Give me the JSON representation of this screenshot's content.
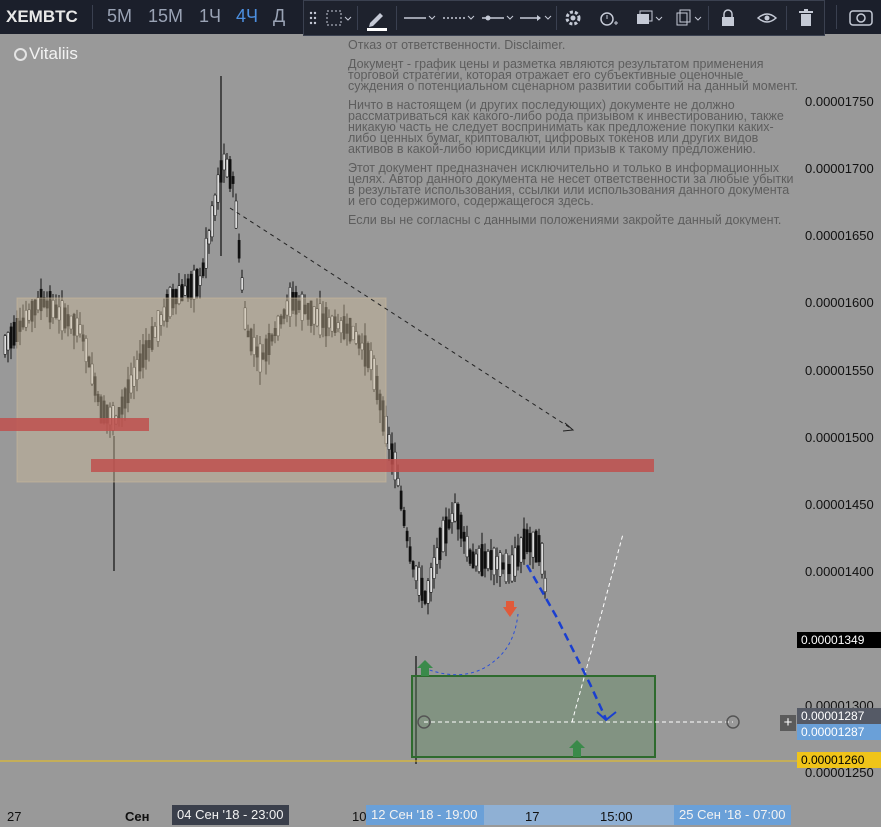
{
  "header": {
    "symbol": "XEMBTC",
    "timeframes": [
      {
        "label": "5M",
        "active": false
      },
      {
        "label": "15M",
        "active": false
      },
      {
        "label": "1Ч",
        "active": false
      },
      {
        "label": "4Ч",
        "active": true
      },
      {
        "label": "Д",
        "active": false
      }
    ]
  },
  "drawing_toolbar": {
    "icons": [
      "drag-handle-icon",
      "frame-icon",
      "pencil-icon",
      "line-color-icon",
      "line-style-dashed-icon",
      "line-ends-icon",
      "arrow-end-icon",
      "settings-icon",
      "alert-icon",
      "layers-icon",
      "clone-icon",
      "lock-icon",
      "visibility-icon",
      "trash-icon",
      "camera-icon"
    ]
  },
  "author": "Vitaliis",
  "disclaimer": {
    "paragraphs": [
      "Отказ от ответственности. Disclaimer.",
      "Документ - график цены и разметка являются результатом применения торговой стратегии, которая отражает его субъективные оценочные суждения о потенциальном сценарном развитии событий на данный момент.",
      "Ничто в настоящем (и других последующих) документе не должно рассматриваться как какого-либо рода призывом к инвестированию, также никакую часть не следует воспринимать как предложение покупки каких-либо ценных бумаг, криптовалют, цифровых токенов или других видов активов в какой-либо юрисдикции или призыв к такому предложению.",
      "Этот документ предназначен исключительно и только в информационных целях. Автор данного документа не несет ответственности за любые убытки в результате использования, ссылки или использования данного документа и его содержимого, содержащегося здесь.",
      "Если вы не согласны с данными положениями закройте данный документ."
    ]
  },
  "price_axis": {
    "ticks": [
      {
        "label": "0.00001750",
        "value": 1750
      },
      {
        "label": "0.00001700",
        "value": 1700
      },
      {
        "label": "0.00001650",
        "value": 1650
      },
      {
        "label": "0.00001600",
        "value": 1600
      },
      {
        "label": "0.00001550",
        "value": 1550
      },
      {
        "label": "0.00001500",
        "value": 1500
      },
      {
        "label": "0.00001450",
        "value": 1450
      },
      {
        "label": "0.00001400",
        "value": 1400
      },
      {
        "label": "0.00001300",
        "value": 1300
      },
      {
        "label": "0.00001250",
        "value": 1250
      }
    ],
    "tags": [
      {
        "label": "0.00001349",
        "value": 1349,
        "bg": "#000000",
        "fg": "#ffffff"
      },
      {
        "label": "0.00001287",
        "value": 1287,
        "bg": "#555a66",
        "fg": "#ffffff"
      },
      {
        "label": "0.00001287",
        "value": 1287,
        "bg": "#6aa0d8",
        "fg": "#ffffff"
      },
      {
        "label": "0.00001260",
        "value": 1260,
        "bg": "#f0c419",
        "fg": "#000000"
      }
    ]
  },
  "time_axis": {
    "labels": [
      "27",
      "Сен",
      "10",
      "17",
      "15:00"
    ],
    "crosshair_pills": [
      "04 Сен '18 - 23:00",
      "12 Сен '18 - 19:00",
      "25 Сен '18 - 07:00"
    ]
  },
  "colors": {
    "background": "#999999",
    "toolbar": "#1b1f2b",
    "accent_timeframe": "#4c8fe0",
    "range_box": "#b5a48a",
    "resistance": "#c0504d",
    "target_box": "#5a8a5a",
    "projection": "#1a3fd0",
    "current_price_line": "#f0c419"
  }
}
